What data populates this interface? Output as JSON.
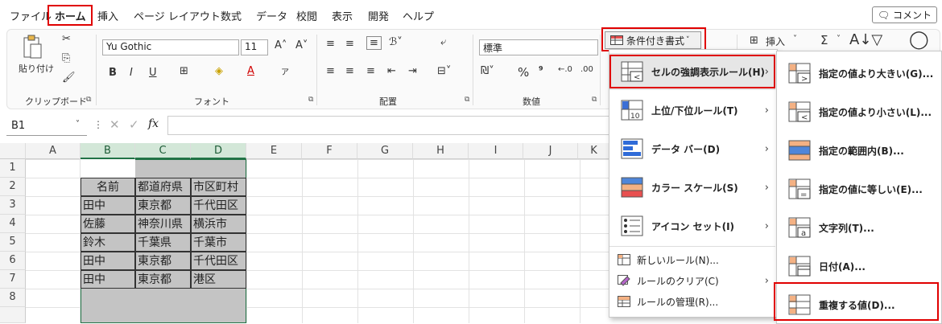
{
  "menubar": {
    "items": [
      "ファイル",
      "ホーム",
      "挿入",
      "ページ レイアウト",
      "数式",
      "データ",
      "校閲",
      "表示",
      "開発",
      "ヘルプ"
    ],
    "active": "ホーム",
    "comment": "コメント"
  },
  "ribbon": {
    "clipboard": {
      "paste": "貼り付け",
      "label": "クリップボード"
    },
    "font": {
      "name": "Yu Gothic",
      "size": "11",
      "label": "フォント",
      "bold": "B",
      "italic": "I",
      "underline": "U"
    },
    "alignment": {
      "label": "配置"
    },
    "number": {
      "format": "標準",
      "label": "数値",
      "percent": "%",
      "comma": "⁹"
    },
    "styles": {
      "conditional": "条件付き書式"
    },
    "cells": {
      "insert": "挿入"
    },
    "editing": {
      "sum": "Σ"
    }
  },
  "formula_bar": {
    "namebox": "B1",
    "fx": "fx"
  },
  "grid": {
    "columns": [
      "A",
      "B",
      "C",
      "D",
      "E",
      "F",
      "G",
      "H",
      "I",
      "J",
      "K"
    ],
    "rows": [
      "1",
      "2",
      "3",
      "4",
      "5",
      "6",
      "7",
      "8"
    ],
    "table": [
      [
        "名前",
        "都道府県",
        "市区町村"
      ],
      [
        "田中",
        "東京都",
        "千代田区"
      ],
      [
        "佐藤",
        "神奈川県",
        "横浜市"
      ],
      [
        "鈴木",
        "千葉県",
        "千葉市"
      ],
      [
        "田中",
        "東京都",
        "千代田区"
      ],
      [
        "田中",
        "東京都",
        "港区"
      ]
    ]
  },
  "cf_menu": {
    "items": [
      {
        "label": "セルの強調表示ルール(H)",
        "icon": "highlight-rules-icon"
      },
      {
        "label": "上位/下位ルール(T)",
        "icon": "top-bottom-icon"
      },
      {
        "label": "データ バー(D)",
        "icon": "data-bars-icon"
      },
      {
        "label": "カラー スケール(S)",
        "icon": "color-scales-icon"
      },
      {
        "label": "アイコン セット(I)",
        "icon": "icon-sets-icon"
      }
    ],
    "small_items": [
      {
        "label": "新しいルール(N)...",
        "icon": "new-rule-icon"
      },
      {
        "label": "ルールのクリア(C)",
        "icon": "clear-rules-icon"
      },
      {
        "label": "ルールの管理(R)...",
        "icon": "manage-rules-icon"
      }
    ]
  },
  "sub_menu": {
    "items": [
      {
        "label": "指定の値より大きい(G)...",
        "icon": "greater-than-icon"
      },
      {
        "label": "指定の値より小さい(L)...",
        "icon": "less-than-icon"
      },
      {
        "label": "指定の範囲内(B)...",
        "icon": "between-icon"
      },
      {
        "label": "指定の値に等しい(E)...",
        "icon": "equal-to-icon"
      },
      {
        "label": "文字列(T)...",
        "icon": "text-contains-icon"
      },
      {
        "label": "日付(A)...",
        "icon": "date-occurring-icon"
      },
      {
        "label": "重複する値(D)...",
        "icon": "duplicate-values-icon"
      }
    ]
  },
  "colors": {
    "accent": "#217346",
    "highlight": "#e00000",
    "selection": "#c4c4c4"
  }
}
